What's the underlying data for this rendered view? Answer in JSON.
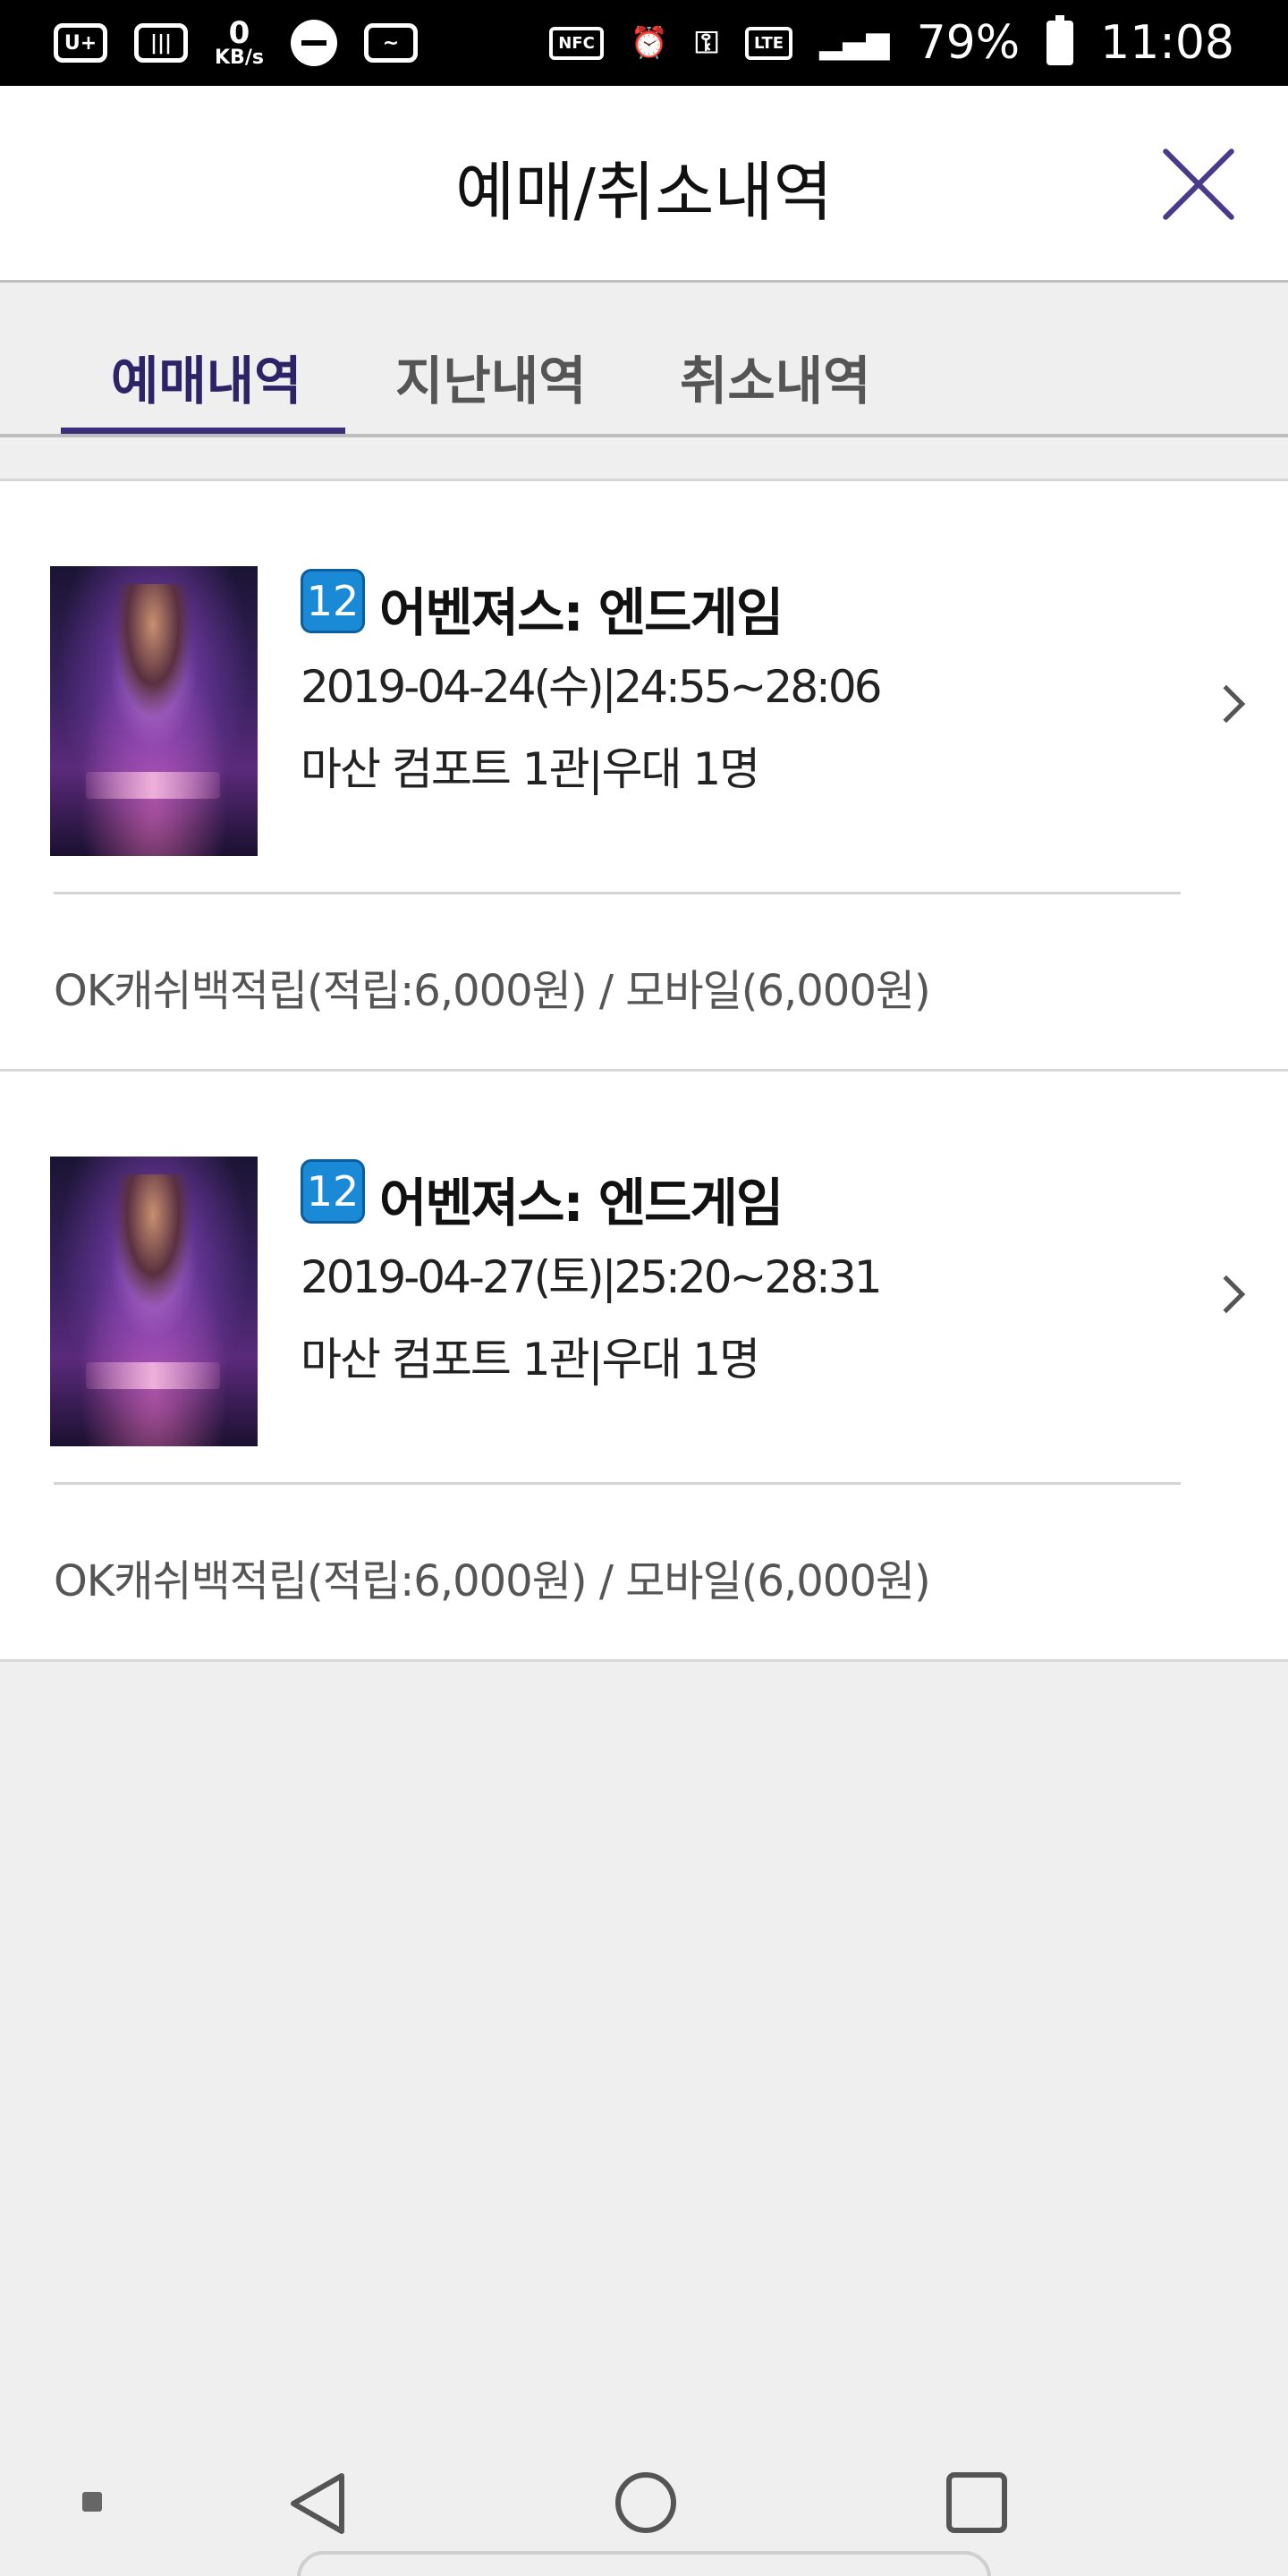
{
  "status_bar": {
    "speed_value": "0",
    "speed_unit": "KB/s",
    "nfc_label": "NFC",
    "lte_label": "LTE",
    "battery": "79%",
    "time": "11:08"
  },
  "header": {
    "title": "예매/취소내역",
    "close_icon": "close-icon",
    "accent_color": "#4b3a8c"
  },
  "tabs": [
    {
      "label": "예매내역",
      "active": true
    },
    {
      "label": "지난내역",
      "active": false
    },
    {
      "label": "취소내역",
      "active": false
    }
  ],
  "bookings": [
    {
      "rating": "12",
      "title": "어벤져스: 엔드게임",
      "datetime": "2019-04-24(수)|24:55~28:06",
      "venue": "마산 컴포트 1관|우대 1명",
      "payment": "OK캐쉬백적립(적립:6,000원) / 모바일(6,000원)"
    },
    {
      "rating": "12",
      "title": "어벤져스: 엔드게임",
      "datetime": "2019-04-27(토)|25:20~28:31",
      "venue": "마산 컴포트 1관|우대 1명",
      "payment": "OK캐쉬백적립(적립:6,000원) / 모바일(6,000원)"
    }
  ],
  "colors": {
    "rating_badge": "#1a8ad6",
    "active_tab": "#2d2367",
    "background": "#efeff0"
  }
}
